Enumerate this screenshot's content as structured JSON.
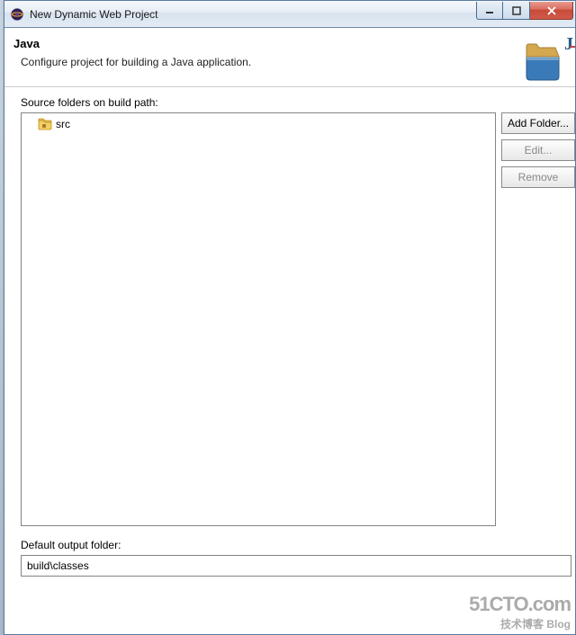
{
  "window": {
    "title": "New Dynamic Web Project"
  },
  "header": {
    "title": "Java",
    "description": "Configure project for building a Java application."
  },
  "source_folders": {
    "label": "Source folders on build path:",
    "items": [
      {
        "name": "src"
      }
    ]
  },
  "buttons": {
    "add_folder": "Add Folder...",
    "edit": "Edit...",
    "remove": "Remove"
  },
  "output": {
    "label": "Default output folder:",
    "value": "build\\classes"
  },
  "watermark": {
    "line1": "51CTO.com",
    "line2": "技术博客  Blog"
  }
}
